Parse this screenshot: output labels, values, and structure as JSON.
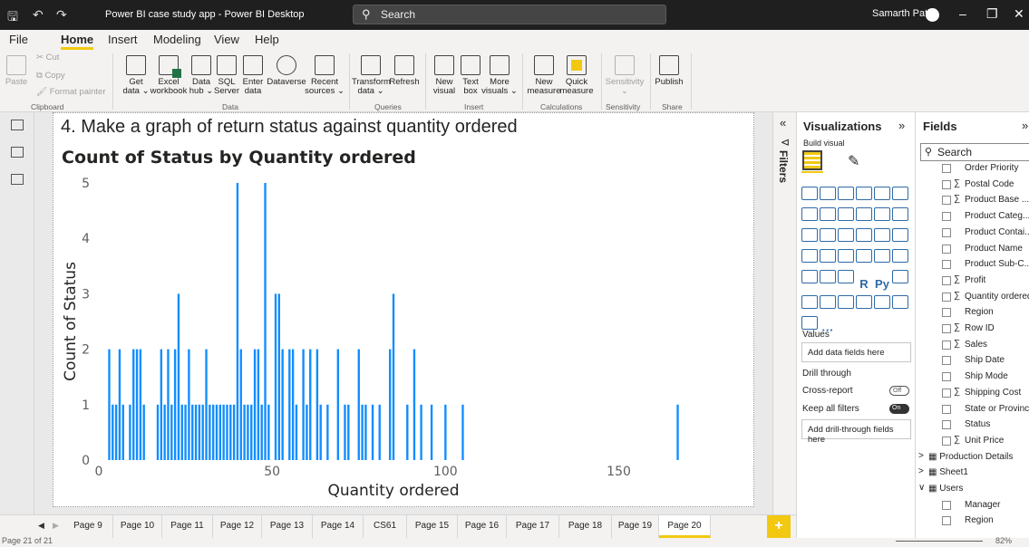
{
  "titlebar": {
    "title": "Power BI case study app - Power BI Desktop",
    "search": "Search",
    "user": "Samarth Patil"
  },
  "menu": [
    "File",
    "Home",
    "Insert",
    "Modeling",
    "View",
    "Help"
  ],
  "ribbon": {
    "clipboard": {
      "paste": "Paste",
      "cut": "Cut",
      "copy": "Copy",
      "format_painter": "Format painter",
      "group": "Clipboard"
    },
    "data": {
      "buttons": [
        {
          "l1": "Get",
          "l2": "data ⌄"
        },
        {
          "l1": "Excel",
          "l2": "workbook"
        },
        {
          "l1": "Data",
          "l2": "hub ⌄"
        },
        {
          "l1": "SQL",
          "l2": "Server"
        },
        {
          "l1": "Enter",
          "l2": "data"
        },
        {
          "l1": "Dataverse",
          "l2": ""
        },
        {
          "l1": "Recent",
          "l2": "sources ⌄"
        }
      ],
      "group": "Data"
    },
    "queries": {
      "transform_l1": "Transform",
      "transform_l2": "data ⌄",
      "refresh": "Refresh",
      "group": "Queries"
    },
    "insert": {
      "buttons": [
        {
          "l1": "New",
          "l2": "visual"
        },
        {
          "l1": "Text",
          "l2": "box"
        },
        {
          "l1": "More",
          "l2": "visuals ⌄"
        }
      ],
      "group": "Insert"
    },
    "calculations": {
      "new_l1": "New",
      "new_l2": "measure",
      "quick_l1": "Quick",
      "quick_l2": "measure",
      "group": "Calculations"
    },
    "sensitivity": {
      "label": "Sensitivity",
      "l2": "⌄",
      "group": "Sensitivity"
    },
    "share": {
      "publish": "Publish",
      "group": "Share"
    }
  },
  "report": {
    "heading": "4. Make a graph of return status against quantity ordered"
  },
  "chart_data": {
    "type": "bar",
    "title": "Count of Status by Quantity ordered",
    "xlabel": "Quantity ordered",
    "ylabel": "Count of Status",
    "xlim": [
      0,
      170
    ],
    "ylim": [
      0,
      5
    ],
    "xticks": [
      0,
      50,
      100,
      150
    ],
    "yticks": [
      0,
      1,
      2,
      3,
      4,
      5
    ],
    "bar_color": "#118dff",
    "x": [
      3,
      4,
      5,
      6,
      7,
      9,
      10,
      11,
      12,
      13,
      17,
      18,
      19,
      20,
      21,
      22,
      23,
      24,
      25,
      26,
      27,
      28,
      29,
      30,
      31,
      32,
      33,
      34,
      35,
      36,
      37,
      38,
      39,
      40,
      41,
      42,
      43,
      44,
      45,
      46,
      47,
      48,
      49,
      51,
      52,
      53,
      55,
      56,
      57,
      59,
      60,
      61,
      63,
      64,
      66,
      69,
      71,
      72,
      75,
      76,
      77,
      79,
      81,
      84,
      85,
      89,
      91,
      93,
      96,
      100,
      105,
      167
    ],
    "values": [
      2,
      1,
      1,
      2,
      1,
      1,
      2,
      2,
      2,
      1,
      1,
      2,
      1,
      2,
      1,
      2,
      3,
      1,
      1,
      2,
      1,
      1,
      1,
      1,
      2,
      1,
      1,
      1,
      1,
      1,
      1,
      1,
      1,
      5,
      2,
      1,
      1,
      1,
      2,
      2,
      1,
      5,
      1,
      3,
      3,
      2,
      2,
      2,
      1,
      2,
      1,
      2,
      2,
      1,
      1,
      2,
      1,
      1,
      2,
      1,
      1,
      1,
      1,
      2,
      3,
      1,
      2,
      1,
      1,
      1,
      1,
      1
    ]
  },
  "filters": {
    "label": "Filters"
  },
  "visualizations": {
    "title": "Visualizations",
    "build_visual": "Build visual",
    "more": "···",
    "values_label": "Values",
    "values_placeholder": "Add data fields here",
    "drill_through": "Drill through",
    "cross_report": "Cross-report",
    "cross_report_state": "Off",
    "keep_all_filters": "Keep all filters",
    "keep_all_filters_state": "On",
    "drill_placeholder": "Add drill-through fields here"
  },
  "fields": {
    "title": "Fields",
    "search": "Search",
    "items": [
      {
        "name": "Order Priority",
        "sigma": ""
      },
      {
        "name": "Postal Code",
        "sigma": "∑"
      },
      {
        "name": "Product Base ...",
        "sigma": "∑"
      },
      {
        "name": "Product Categ...",
        "sigma": ""
      },
      {
        "name": "Product Contai...",
        "sigma": ""
      },
      {
        "name": "Product Name",
        "sigma": ""
      },
      {
        "name": "Product Sub-C...",
        "sigma": ""
      },
      {
        "name": "Profit",
        "sigma": "∑"
      },
      {
        "name": "Quantity ordered",
        "sigma": "∑"
      },
      {
        "name": "Region",
        "sigma": ""
      },
      {
        "name": "Row ID",
        "sigma": "∑"
      },
      {
        "name": "Sales",
        "sigma": "∑"
      },
      {
        "name": "Ship Date",
        "sigma": ""
      },
      {
        "name": "Ship Mode",
        "sigma": ""
      },
      {
        "name": "Shipping Cost",
        "sigma": "∑"
      },
      {
        "name": "State or Province",
        "sigma": ""
      },
      {
        "name": "Status",
        "sigma": ""
      },
      {
        "name": "Unit Price",
        "sigma": "∑"
      }
    ],
    "tables": [
      {
        "name": "Production Details",
        "arrow": ">"
      },
      {
        "name": "Sheet1",
        "arrow": ">"
      },
      {
        "name": "Users",
        "arrow": "∨"
      }
    ],
    "user_fields": [
      "Manager",
      "Region"
    ]
  },
  "page_tabs": [
    "Page 9",
    "Page 10",
    "Page 11",
    "Page 12",
    "Page 13",
    "Page 14",
    "CS61",
    "Page 15",
    "Page 16",
    "Page 17",
    "Page 18",
    "Page 19",
    "Page 20"
  ],
  "active_tab": "Page 20",
  "status": {
    "page": "Page 21 of 21",
    "zoom": "82%"
  }
}
